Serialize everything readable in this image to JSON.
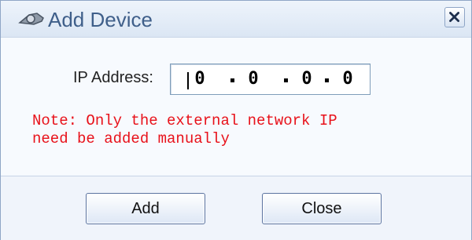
{
  "window": {
    "title": "Add Device",
    "icon": "device-search-icon",
    "close_icon": "close-icon"
  },
  "form": {
    "ip_label": "IP Address:",
    "ip_octets": [
      "0",
      "0",
      "0",
      "0"
    ]
  },
  "note": "Note: Only the external network IP\nneed be added manually",
  "buttons": {
    "add_label": "Add",
    "close_label": "Close"
  },
  "colors": {
    "title": "#3f5f8a",
    "note": "#e8111a",
    "border": "#8fa6c6"
  }
}
